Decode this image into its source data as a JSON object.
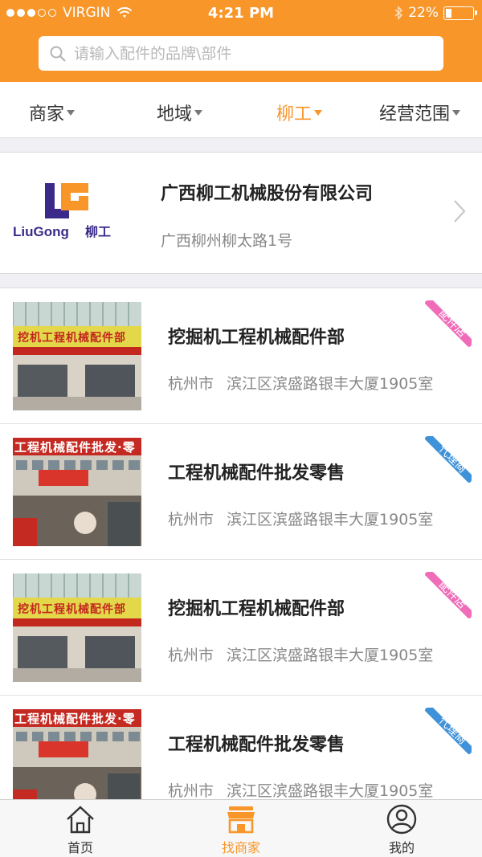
{
  "status_bar": {
    "carrier": "VIRGIN",
    "time": "4:21 PM",
    "battery": "22%",
    "battery_level": 0.22,
    "signal_bars": 3
  },
  "search": {
    "placeholder": "请输入配件的品牌\\部件"
  },
  "filters": [
    {
      "label": "商家",
      "active": false
    },
    {
      "label": "地域",
      "active": false
    },
    {
      "label": "柳工",
      "active": true
    },
    {
      "label": "经营范围",
      "active": false
    }
  ],
  "featured": {
    "logo_text": "LiuGong 柳工",
    "name": "广西柳工机械股份有限公司",
    "address": "广西柳州柳太路1号"
  },
  "listings": [
    {
      "name": "挖掘机工程机械配件部",
      "city": "杭州市",
      "address": "滨江区滨盛路银丰大厦1905室",
      "tag": "配件店",
      "tag_color": "#f06bb8",
      "sign_text": "挖机工程机械配件部"
    },
    {
      "name": "工程机械配件批发零售",
      "city": "杭州市",
      "address": "滨江区滨盛路银丰大厦1905室",
      "tag": "代理商",
      "tag_color": "#3f92d9",
      "sign_text": "工程机械配件批发·零"
    },
    {
      "name": "挖掘机工程机械配件部",
      "city": "杭州市",
      "address": "滨江区滨盛路银丰大厦1905室",
      "tag": "配件店",
      "tag_color": "#f06bb8",
      "sign_text": "挖机工程机械配件部"
    },
    {
      "name": "工程机械配件批发零售",
      "city": "杭州市",
      "address": "滨江区滨盛路银丰大厦1905室",
      "tag": "代理商",
      "tag_color": "#3f92d9",
      "sign_text": "工程机械配件批发·零"
    }
  ],
  "tabbar": [
    {
      "label": "首页",
      "icon": "home-icon",
      "active": false
    },
    {
      "label": "找商家",
      "icon": "shop-icon",
      "active": true
    },
    {
      "label": "我的",
      "icon": "user-icon",
      "active": false
    }
  ],
  "colors": {
    "accent": "#f8962a",
    "logo_purple": "#3c2a8a"
  }
}
